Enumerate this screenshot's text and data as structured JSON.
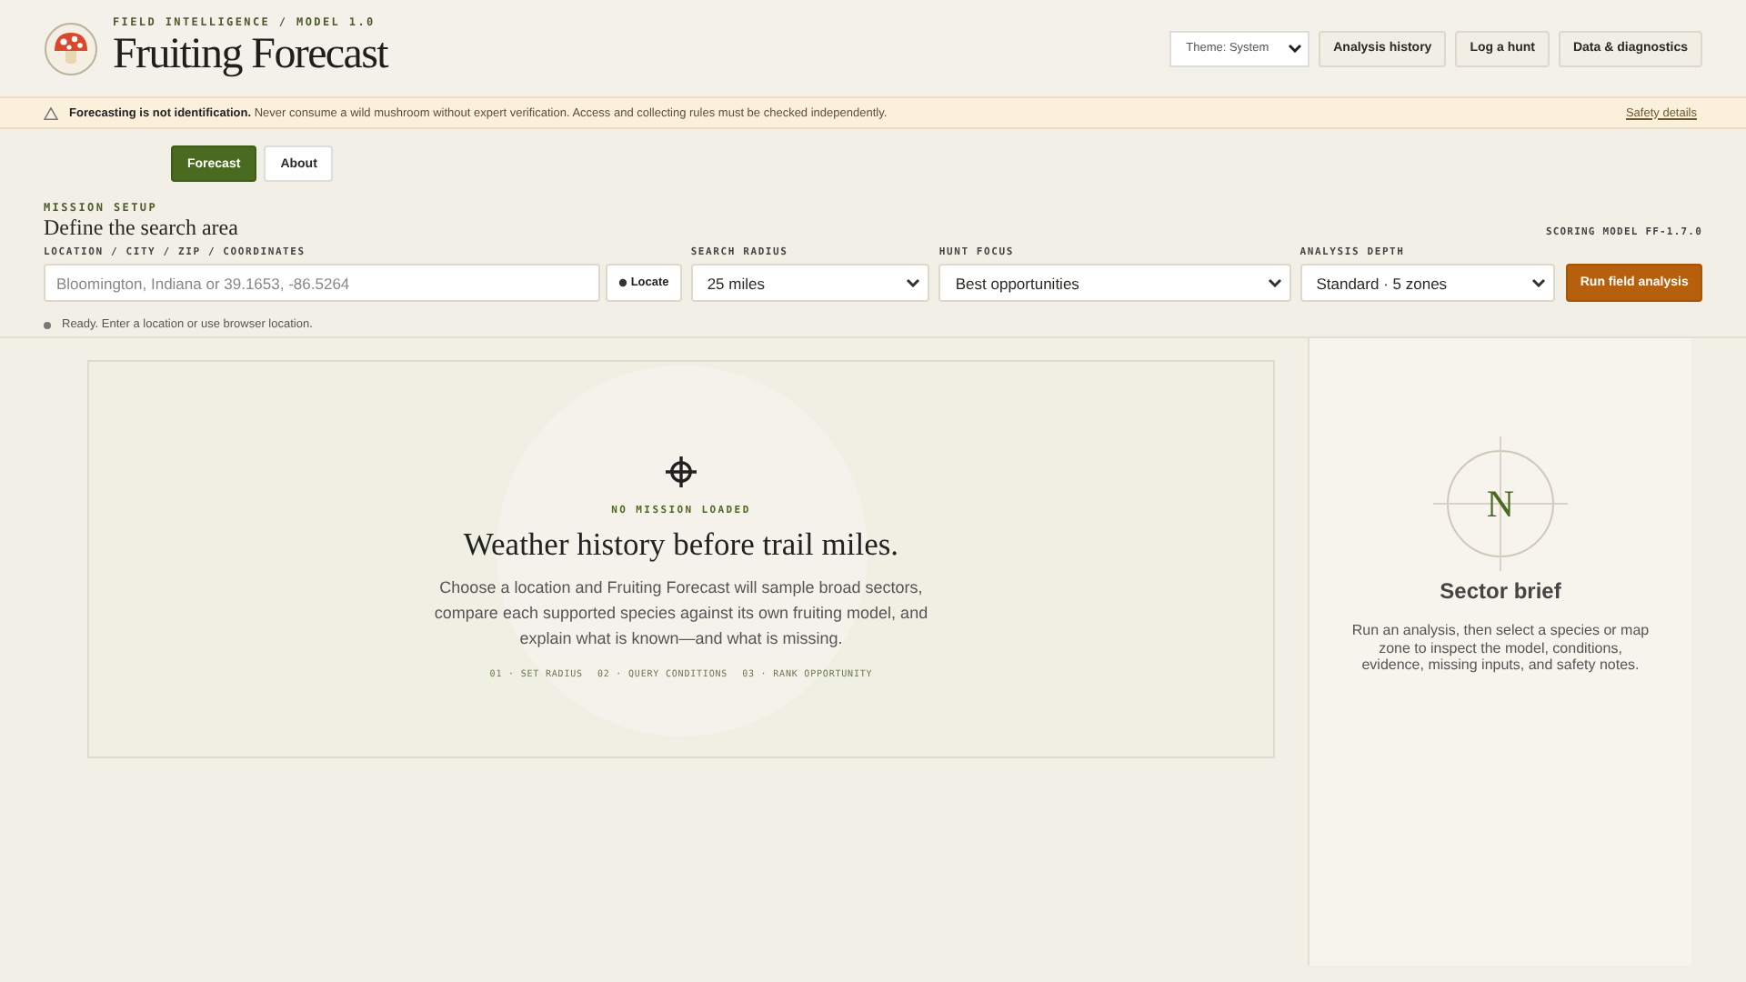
{
  "header": {
    "eyebrow": "FIELD INTELLIGENCE / MODEL 1.0",
    "title": "Fruiting Forecast",
    "theme_select": {
      "value": "Theme: System"
    },
    "buttons": [
      "Analysis history",
      "Log a hunt",
      "Data & diagnostics"
    ]
  },
  "warning": {
    "text": "**Forecasting is not identification.** Never consume a wild mushroom without expert verification. Access and collecting rules must be checked independently.",
    "link": "Safety details"
  },
  "tabs": [
    {
      "label": "Forecast",
      "selected": true
    },
    {
      "label": "About",
      "selected": false
    }
  ],
  "mission": {
    "eyebrow": "MISSION SETUP",
    "title": "Define the search area",
    "model": "SCORING MODEL FF-1.7.0",
    "location": {
      "label": "LOCATION / CITY / ZIP / COORDINATES",
      "placeholder": "Bloomington, Indiana or 39.1653, -86.5264",
      "button": "Locate"
    },
    "selects": [
      {
        "label": "SEARCH RADIUS",
        "value": "25 miles"
      },
      {
        "label": "HUNT FOCUS",
        "value": "Best opportunities"
      },
      {
        "label": "ANALYSIS DEPTH",
        "value": "Standard · 5 zones"
      }
    ],
    "run_button": "Run field analysis",
    "status": "Ready. Enter a location or use browser location."
  },
  "empty_state": {
    "eyebrow": "NO MISSION LOADED",
    "title": "Weather history before trail miles.",
    "text": "Choose a location and Fruiting Forecast will sample broad sectors, compare each supported species against its own fruiting model, and explain what is known—and what is missing.",
    "steps": [
      "01 · SET RADIUS",
      "02 · QUERY CONDITIONS",
      "03 · RANK OPPORTUNITY"
    ]
  },
  "sector_brief": {
    "compass_letter": "N",
    "title": "Sector brief",
    "text": "Run an analysis, then select a species or map zone to inspect the model, conditions, evidence, missing inputs, and safety notes."
  }
}
